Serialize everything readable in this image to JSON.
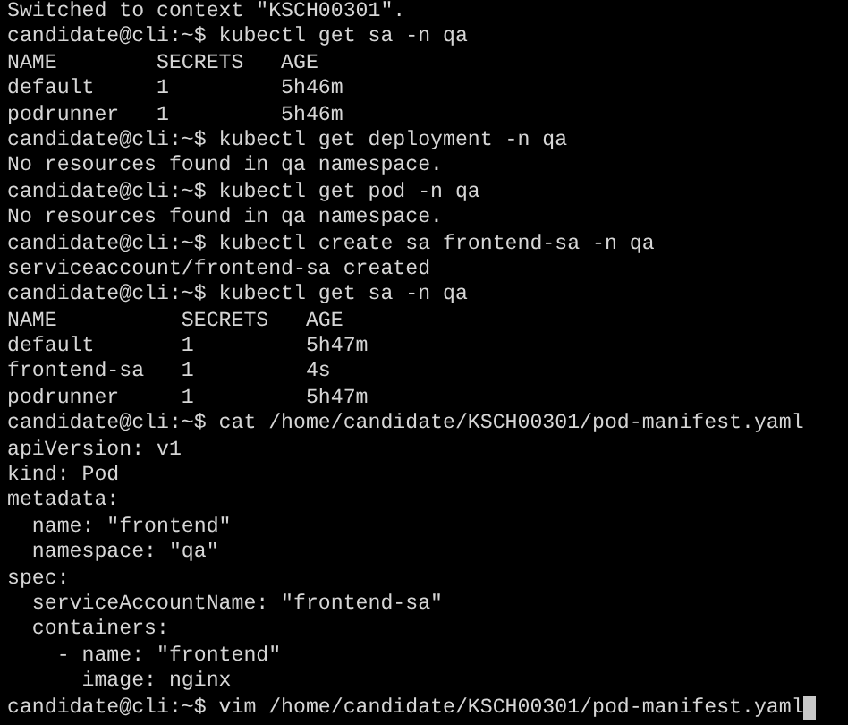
{
  "terminal": {
    "lines": [
      "Switched to context \"KSCH00301\".",
      "candidate@cli:~$ kubectl get sa -n qa",
      "NAME        SECRETS   AGE",
      "default     1         5h46m",
      "podrunner   1         5h46m",
      "candidate@cli:~$ kubectl get deployment -n qa",
      "No resources found in qa namespace.",
      "candidate@cli:~$ kubectl get pod -n qa",
      "No resources found in qa namespace.",
      "candidate@cli:~$ kubectl create sa frontend-sa -n qa",
      "serviceaccount/frontend-sa created",
      "candidate@cli:~$ kubectl get sa -n qa",
      "NAME          SECRETS   AGE",
      "default       1         5h47m",
      "frontend-sa   1         4s",
      "podrunner     1         5h47m",
      "candidate@cli:~$ cat /home/candidate/KSCH00301/pod-manifest.yaml",
      "apiVersion: v1",
      "kind: Pod",
      "metadata:",
      "  name: \"frontend\"",
      "  namespace: \"qa\"",
      "spec:",
      "  serviceAccountName: \"frontend-sa\"",
      "  containers:",
      "    - name: \"frontend\"",
      "      image: nginx",
      "candidate@cli:~$ vim /home/candidate/KSCH00301/pod-manifest.yaml"
    ],
    "cursor_visible": true
  }
}
